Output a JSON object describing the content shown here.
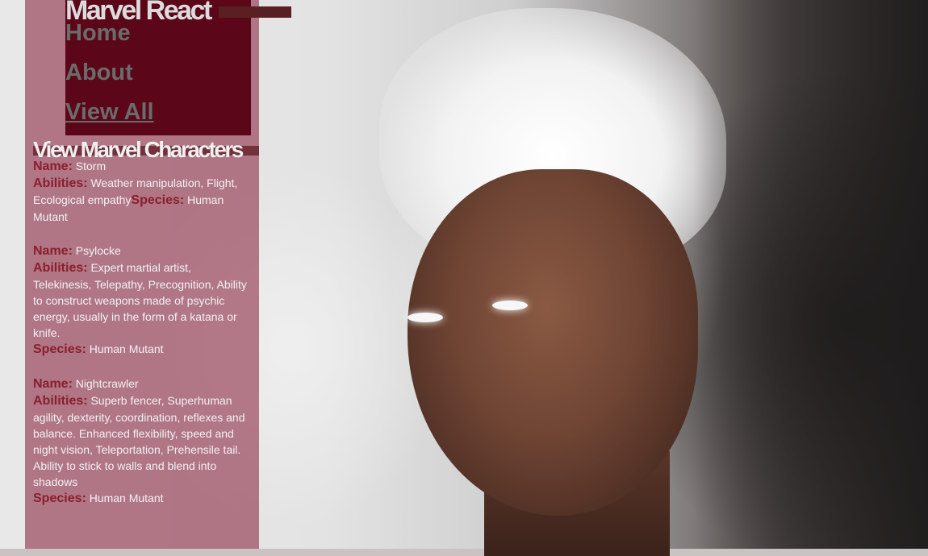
{
  "brand": {
    "title": "Marvel React"
  },
  "nav": [
    {
      "label": "Home"
    },
    {
      "label": "About"
    },
    {
      "label": "View All"
    }
  ],
  "section": {
    "title": "View Marvel Characters"
  },
  "labels": {
    "name": "Name:",
    "abilities": "Abilities:",
    "species": "Species:"
  },
  "characters": [
    {
      "name": "Storm",
      "abilities": "Weather manipulation, Flight, Ecological empathy",
      "species": "Human Mutant"
    },
    {
      "name": "Psylocke",
      "abilities": "Expert martial artist, Telekinesis, Telepathy, Precognition, Ability to construct weapons made of psychic energy, usually in the form of a katana or knife.",
      "species": "Human Mutant"
    },
    {
      "name": "Nightcrawler",
      "abilities": "Superb fencer, Superhuman agility, dexterity, coordination, reflexes and balance. Enhanced flexibility, speed and night vision, Teleportation, Prehensile tail. Ability to stick to walls and blend into shadows",
      "species": "Human Mutant"
    }
  ],
  "colors": {
    "sidebar": "#841a34",
    "nav_box": "#5b0719",
    "label": "#8a1e2c"
  }
}
